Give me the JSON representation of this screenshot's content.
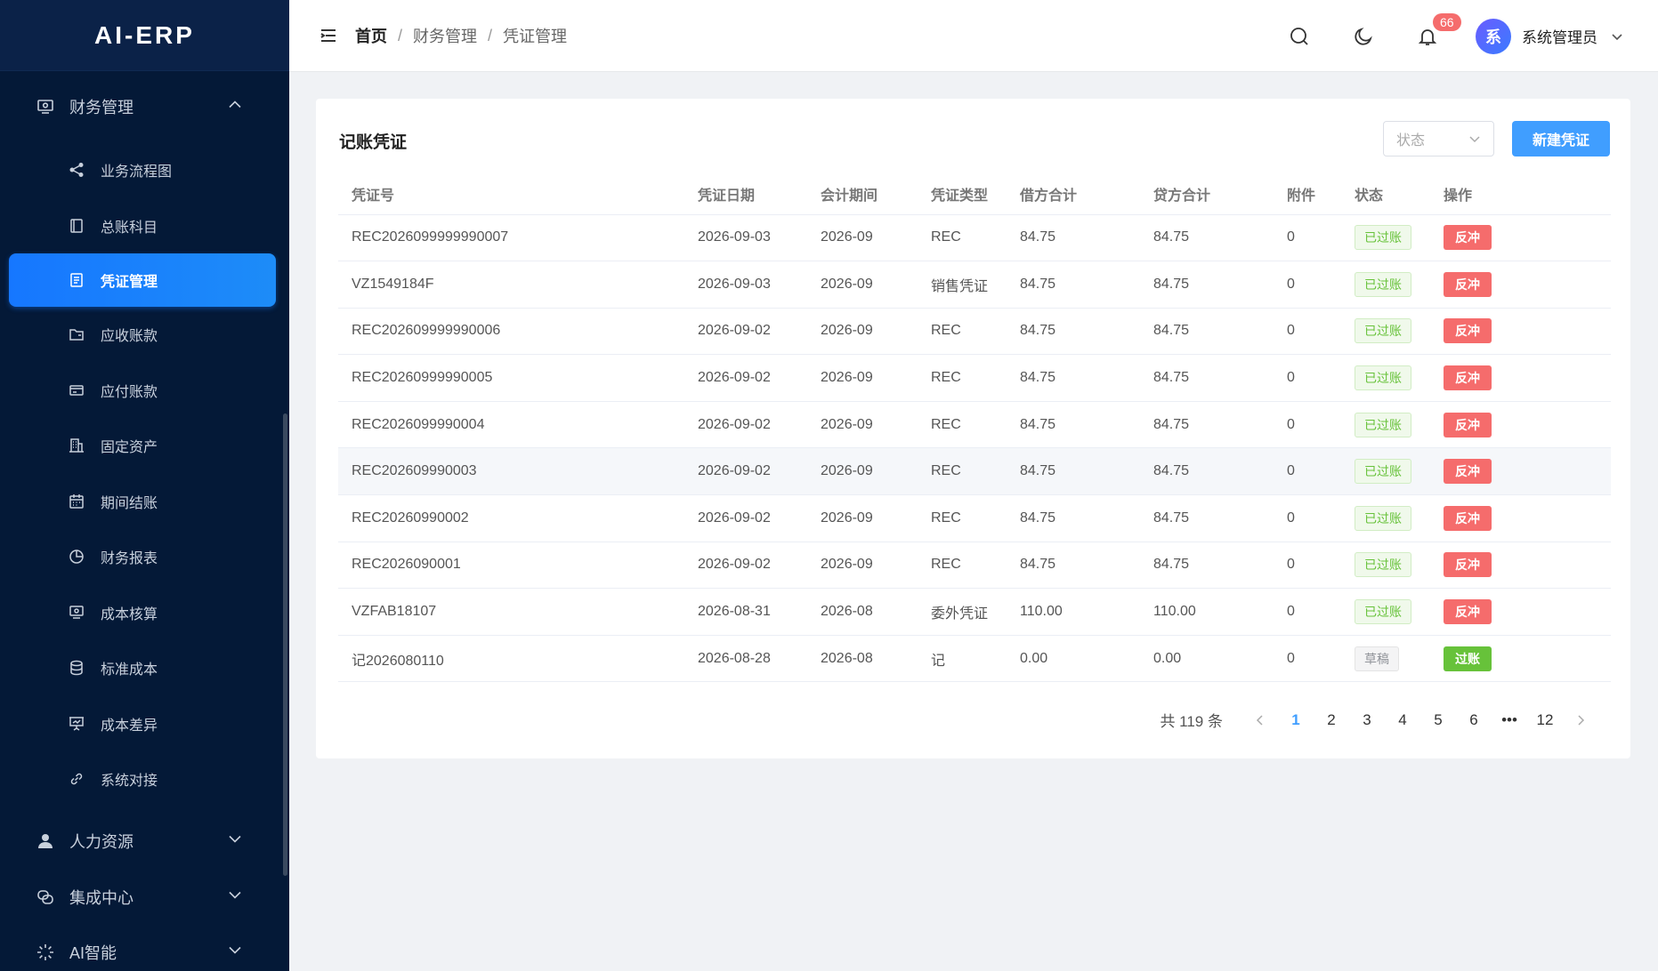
{
  "app": {
    "logo": "AI-ERP"
  },
  "sidebar": {
    "group_finance": "财务管理",
    "items": [
      {
        "label": "业务流程图",
        "icon": "share-icon"
      },
      {
        "label": "总账科目",
        "icon": "book-icon"
      },
      {
        "label": "凭证管理",
        "icon": "document-icon",
        "active": true
      },
      {
        "label": "应收账款",
        "icon": "folder-icon"
      },
      {
        "label": "应付账款",
        "icon": "card-icon"
      },
      {
        "label": "固定资产",
        "icon": "building-icon"
      },
      {
        "label": "期间结账",
        "icon": "calendar-icon"
      },
      {
        "label": "财务报表",
        "icon": "pie-chart-icon"
      },
      {
        "label": "成本核算",
        "icon": "monitor-icon"
      },
      {
        "label": "标准成本",
        "icon": "database-icon"
      },
      {
        "label": "成本差异",
        "icon": "presentation-icon"
      },
      {
        "label": "系统对接",
        "icon": "link-icon"
      }
    ],
    "group_hr": "人力资源",
    "group_integration": "集成中心",
    "group_ai": "AI智能"
  },
  "header": {
    "breadcrumb": [
      "首页",
      "财务管理",
      "凭证管理"
    ],
    "notification_count": "66",
    "avatar_text": "系",
    "username": "系统管理员"
  },
  "card": {
    "title": "记账凭证",
    "status_placeholder": "状态",
    "new_button": "新建凭证"
  },
  "table": {
    "columns": [
      "凭证号",
      "凭证日期",
      "会计期间",
      "凭证类型",
      "借方合计",
      "贷方合计",
      "附件",
      "状态",
      "操作"
    ],
    "rows": [
      [
        "REC2026099999990007",
        "2026-09-03",
        "2026-09",
        "REC",
        "84.75",
        "84.75",
        "0",
        "已过账",
        "反冲"
      ],
      [
        "VZ1549184F",
        "2026-09-03",
        "2026-09",
        "销售凭证",
        "84.75",
        "84.75",
        "0",
        "已过账",
        "反冲"
      ],
      [
        "REC202609999990006",
        "2026-09-02",
        "2026-09",
        "REC",
        "84.75",
        "84.75",
        "0",
        "已过账",
        "反冲"
      ],
      [
        "REC20260999990005",
        "2026-09-02",
        "2026-09",
        "REC",
        "84.75",
        "84.75",
        "0",
        "已过账",
        "反冲"
      ],
      [
        "REC2026099990004",
        "2026-09-02",
        "2026-09",
        "REC",
        "84.75",
        "84.75",
        "0",
        "已过账",
        "反冲"
      ],
      [
        "REC202609990003",
        "2026-09-02",
        "2026-09",
        "REC",
        "84.75",
        "84.75",
        "0",
        "已过账",
        "反冲"
      ],
      [
        "REC20260990002",
        "2026-09-02",
        "2026-09",
        "REC",
        "84.75",
        "84.75",
        "0",
        "已过账",
        "反冲"
      ],
      [
        "REC2026090001",
        "2026-09-02",
        "2026-09",
        "REC",
        "84.75",
        "84.75",
        "0",
        "已过账",
        "反冲"
      ],
      [
        "VZFAB18107",
        "2026-08-31",
        "2026-08",
        "委外凭证",
        "110.00",
        "110.00",
        "0",
        "已过账",
        "反冲"
      ],
      [
        "记2026080110",
        "2026-08-28",
        "2026-08",
        "记",
        "0.00",
        "0.00",
        "0",
        "草稿",
        "过账"
      ]
    ]
  },
  "pagination": {
    "total": "共 119 条",
    "pages": [
      "1",
      "2",
      "3",
      "4",
      "5",
      "6",
      "•••",
      "12"
    ],
    "current": "1"
  }
}
